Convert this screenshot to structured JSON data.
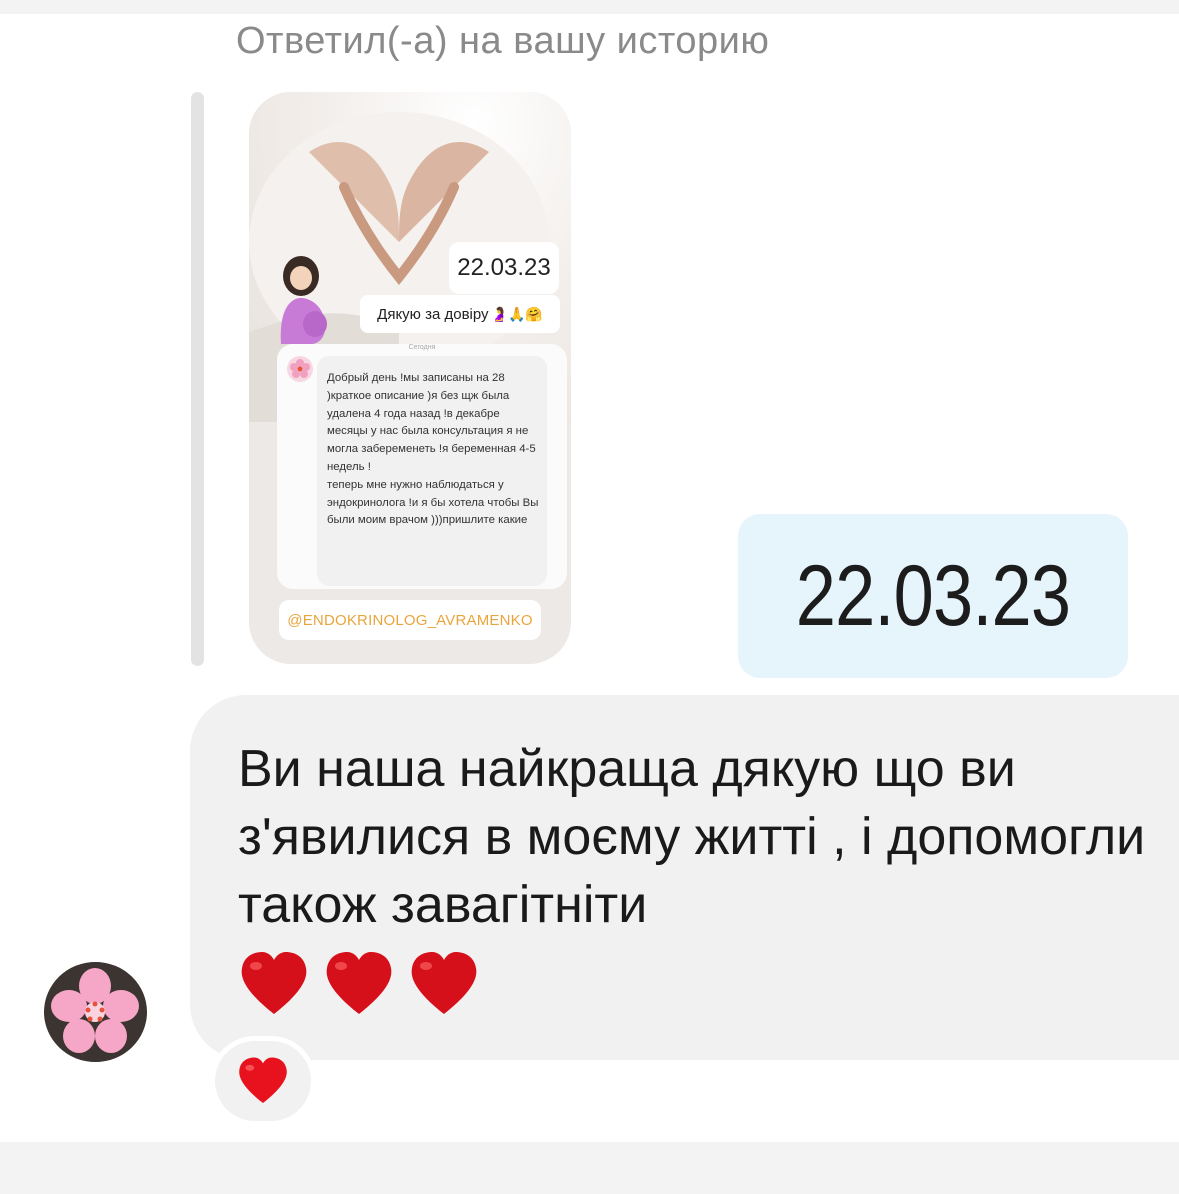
{
  "thread": {
    "reply_caption": "Ответил(-а) на вашу историю",
    "story": {
      "date_label": "22.03.23",
      "thanks_label": "Дякую за довіру",
      "thanks_emojis": "🤰🙏🤗",
      "chat_today": "Сегодня",
      "chat_message": "Добрый день !мы записаны на 28 )краткое описание )я без щж была удалена 4 года назад !в декабре месяцы у нас была консультация я не могла забеременеть !я беременная 4-5 недель !\nтеперь мне нужно наблюдаться у эндокринолога !и я бы хотела чтобы Вы были моим врачом )))пришлите какие",
      "handle": "@ENDOKRINOLOG_AVRAMENKO"
    },
    "outgoing_message": "22.03.23",
    "incoming_message": "Ви наша найкраща дякую що ви з'явилися в моєму житті , і допомогли також завагітніти",
    "incoming_hearts": [
      "heart-icon",
      "heart-icon",
      "heart-icon"
    ],
    "reaction": "heart-icon",
    "avatar_icon": "cherry-blossom-icon"
  },
  "colors": {
    "incoming_bubble": "#f1f1f1",
    "outgoing_bubble": "#e6f5fc",
    "heart": "#d6101b",
    "handle_text": "#e9a53d"
  }
}
